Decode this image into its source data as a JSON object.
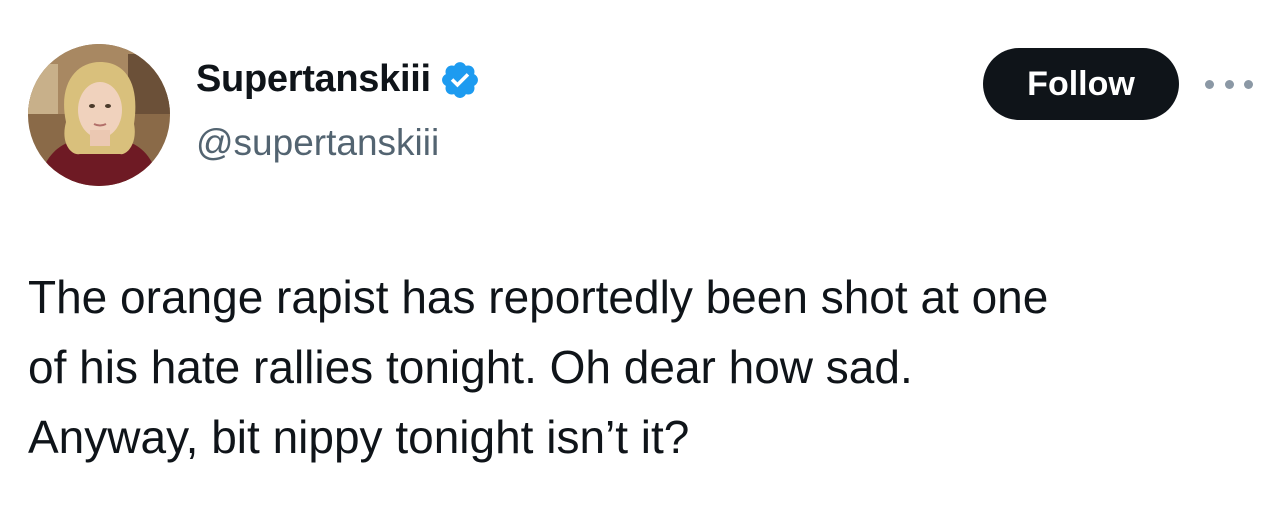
{
  "author": {
    "display_name": "Supertanskiii",
    "handle": "@supertanskiii",
    "verified": true,
    "avatar_icon": "profile-photo"
  },
  "actions": {
    "follow_label": "Follow",
    "more_icon": "more-horizontal-icon"
  },
  "tweet": {
    "lines": [
      "The orange rapist has reportedly been shot at one",
      "of his hate rallies tonight. Oh dear how sad.",
      "Anyway, bit nippy tonight isn’t it?"
    ]
  },
  "colors": {
    "text_primary": "#0f1419",
    "text_secondary": "#536471",
    "verified_blue": "#1d9bf0",
    "follow_bg": "#0f1419",
    "follow_text": "#ffffff",
    "more_dots": "#8b98a5"
  }
}
